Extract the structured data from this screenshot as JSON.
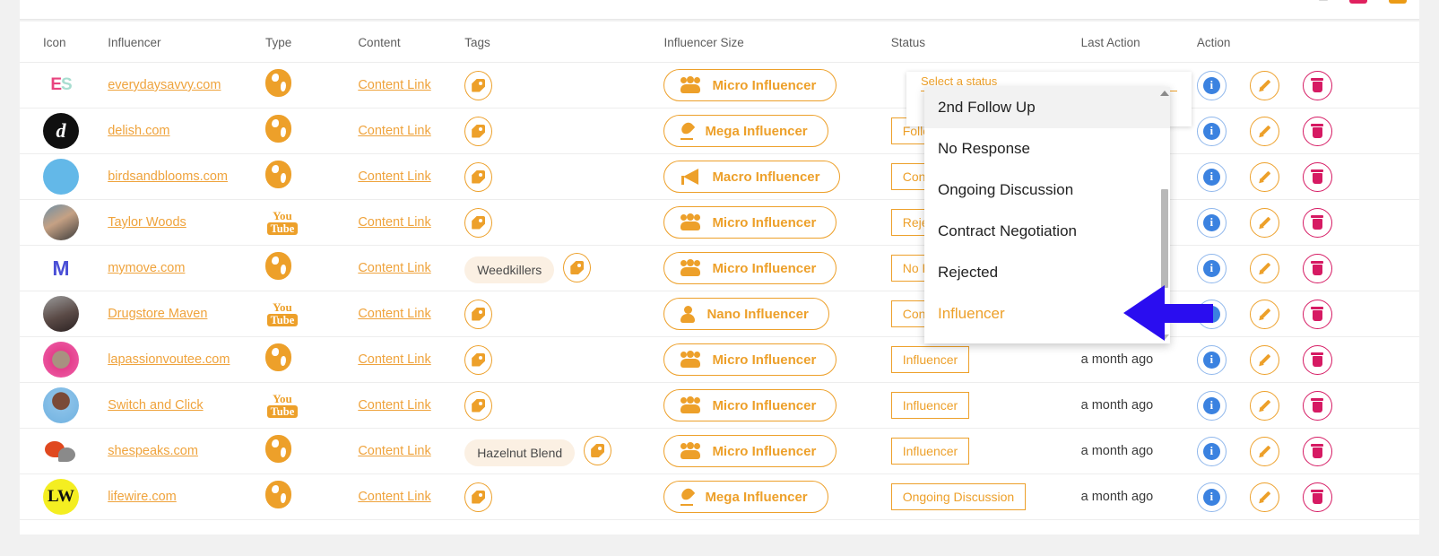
{
  "table": {
    "columns": [
      "Icon",
      "Influencer",
      "Type",
      "Content",
      "Tags",
      "Influencer Size",
      "Status",
      "Last Action",
      "Action"
    ],
    "content_link_label": "Content Link",
    "rows": [
      {
        "avatar_text": "ES",
        "avatar_class": "av-es",
        "influencer": "everydaysavvy.com",
        "type": "globe",
        "tag": "",
        "size": "Micro Influencer",
        "size_icon": "group",
        "status": "",
        "status_hidden": true,
        "last_action": ""
      },
      {
        "avatar_text": "d",
        "avatar_class": "av-d",
        "influencer": "delish.com",
        "type": "globe",
        "tag": "",
        "size": "Mega Influencer",
        "size_icon": "flame",
        "status": "Follow Up",
        "status_hidden": true,
        "last_action": ""
      },
      {
        "avatar_text": "",
        "avatar_class": "av-b",
        "influencer": "birdsandblooms.com",
        "type": "globe",
        "tag": "",
        "size": "Macro Influencer",
        "size_icon": "mega",
        "status": "Contract Negotiation",
        "status_hidden": true,
        "last_action": ""
      },
      {
        "avatar_text": "",
        "avatar_class": "av-tw",
        "influencer": "Taylor Woods",
        "type": "youtube",
        "tag": "",
        "size": "Micro Influencer",
        "size_icon": "group",
        "status": "Rejected",
        "status_hidden": true,
        "last_action": ""
      },
      {
        "avatar_text": "M",
        "avatar_class": "av-mm",
        "influencer": "mymove.com",
        "type": "globe",
        "tag": "Weedkillers",
        "size": "Micro Influencer",
        "size_icon": "group",
        "status": "No Response",
        "status_hidden": true,
        "last_action": ""
      },
      {
        "avatar_text": "",
        "avatar_class": "av-dm",
        "influencer": "Drugstore Maven",
        "type": "youtube",
        "tag": "",
        "size": "Nano Influencer",
        "size_icon": "person",
        "status": "Contract Negotiation",
        "status_hidden": true,
        "last_action": ""
      },
      {
        "avatar_text": "",
        "avatar_class": "av-lp",
        "influencer": "lapassionvoutee.com",
        "type": "globe",
        "tag": "",
        "size": "Micro Influencer",
        "size_icon": "group",
        "status": "Influencer",
        "status_hidden": false,
        "last_action": "a month ago"
      },
      {
        "avatar_text": "",
        "avatar_class": "av-sc",
        "influencer": "Switch and Click",
        "type": "youtube",
        "tag": "",
        "size": "Micro Influencer",
        "size_icon": "group",
        "status": "Influencer",
        "status_hidden": false,
        "last_action": "a month ago"
      },
      {
        "avatar_text": "",
        "avatar_class": "av-ss",
        "influencer": "shespeaks.com",
        "type": "globe",
        "tag": "Hazelnut Blend",
        "size": "Micro Influencer",
        "size_icon": "group",
        "status": "Influencer",
        "status_hidden": false,
        "last_action": "a month ago"
      },
      {
        "avatar_text": "LW",
        "avatar_class": "av-lw",
        "influencer": "lifewire.com",
        "type": "globe",
        "tag": "",
        "size": "Mega Influencer",
        "size_icon": "flame",
        "status": "Ongoing Discussion",
        "status_hidden": false,
        "last_action": "a month ago"
      }
    ]
  },
  "status_dropdown": {
    "label": "Select a status",
    "options": [
      {
        "label": "2nd Follow Up",
        "selected": true,
        "highlighted": false
      },
      {
        "label": "No Response",
        "selected": false,
        "highlighted": false
      },
      {
        "label": "Ongoing Discussion",
        "selected": false,
        "highlighted": false
      },
      {
        "label": "Contract Negotiation",
        "selected": false,
        "highlighted": false
      },
      {
        "label": "Rejected",
        "selected": false,
        "highlighted": false
      },
      {
        "label": "Influencer",
        "selected": false,
        "highlighted": true
      }
    ]
  },
  "colors": {
    "accent_orange": "#eda02a",
    "link_orange": "#efa33c",
    "info_blue": "#3b82e0",
    "delete_pink": "#d61a63",
    "annotation_arrow": "#2a0df0",
    "tag_pill_bg": "#fbf0e3"
  },
  "actions": {
    "info_label": "i",
    "edit_label": "edit",
    "delete_label": "delete"
  }
}
